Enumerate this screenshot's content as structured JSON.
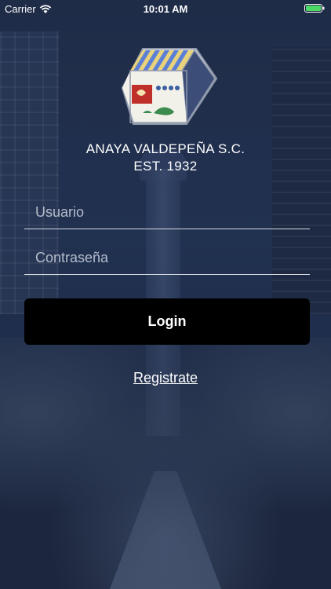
{
  "status_bar": {
    "carrier": "Carrier",
    "time": "10:01 AM",
    "battery_color": "#4cd964"
  },
  "logo": {
    "icon": "company-crest-logo",
    "colors": {
      "stripes_blue": "#5b7fd6",
      "stripes_gold": "#e8d27a",
      "frame": "#9aa3b5",
      "shield_red": "#c0302a",
      "leaf_green": "#3b8a4e"
    }
  },
  "company": {
    "name": "ANAYA VALDEPEÑA S.C.",
    "established": "EST. 1932"
  },
  "form": {
    "username_placeholder": "Usuario",
    "password_placeholder": "Contraseña",
    "login_label": "Login",
    "register_label": "Registrate"
  },
  "theme": {
    "background": "#1f2c48",
    "button_bg": "#000000",
    "text": "#ffffff"
  }
}
